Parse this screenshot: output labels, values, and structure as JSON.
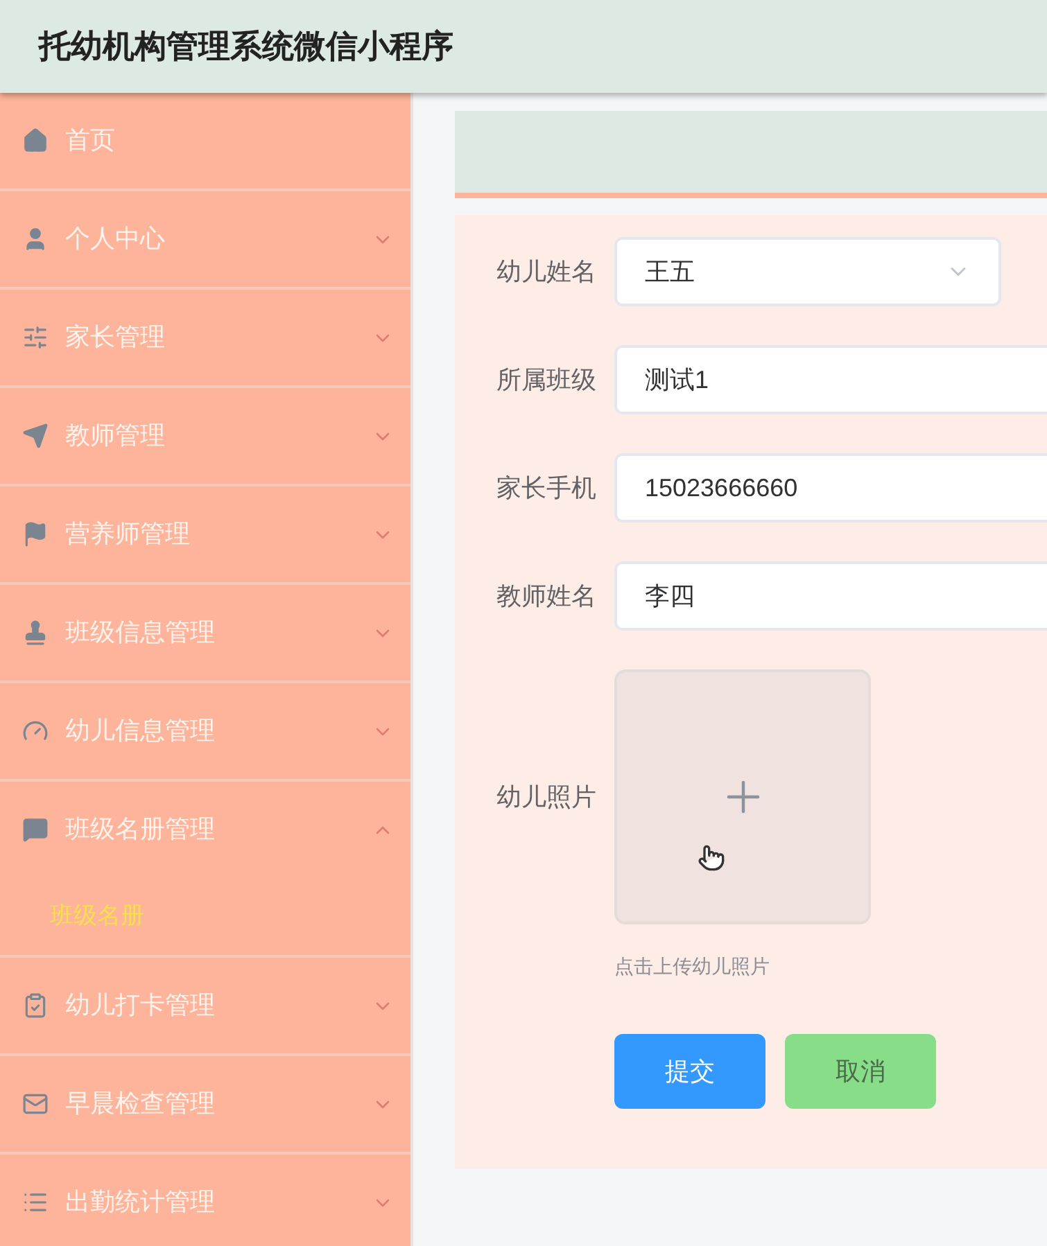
{
  "header": {
    "title": "托幼机构管理系统微信小程序"
  },
  "sidebar": {
    "items": [
      {
        "kind": "link",
        "label": "首页"
      },
      {
        "kind": "submenu",
        "label": "个人中心",
        "expanded": false
      },
      {
        "kind": "submenu",
        "label": "家长管理",
        "expanded": false
      },
      {
        "kind": "submenu",
        "label": "教师管理",
        "expanded": false
      },
      {
        "kind": "submenu",
        "label": "营养师管理",
        "expanded": false
      },
      {
        "kind": "submenu",
        "label": "班级信息管理",
        "expanded": false
      },
      {
        "kind": "submenu",
        "label": "幼儿信息管理",
        "expanded": false
      },
      {
        "kind": "submenu",
        "label": "班级名册管理",
        "expanded": true,
        "children": [
          {
            "label": "班级名册",
            "selected": true
          }
        ]
      },
      {
        "kind": "submenu",
        "label": "幼儿打卡管理",
        "expanded": false
      },
      {
        "kind": "submenu",
        "label": "早晨检查管理",
        "expanded": false
      },
      {
        "kind": "submenu",
        "label": "出勤统计管理",
        "expanded": false
      }
    ]
  },
  "form": {
    "fields": [
      {
        "kind": "select",
        "label": "幼儿姓名",
        "value": "王五"
      },
      {
        "kind": "text",
        "label": "所属班级",
        "value": "测试1"
      },
      {
        "kind": "text",
        "label": "家长手机",
        "value": "15023666660"
      },
      {
        "kind": "text",
        "label": "教师姓名",
        "value": "李四"
      },
      {
        "kind": "upload",
        "label": "幼儿照片",
        "hint": "点击上传幼儿照片"
      }
    ],
    "buttons": [
      {
        "kind": "primary",
        "label": "提交"
      },
      {
        "kind": "secondary",
        "label": "取消"
      }
    ]
  }
}
